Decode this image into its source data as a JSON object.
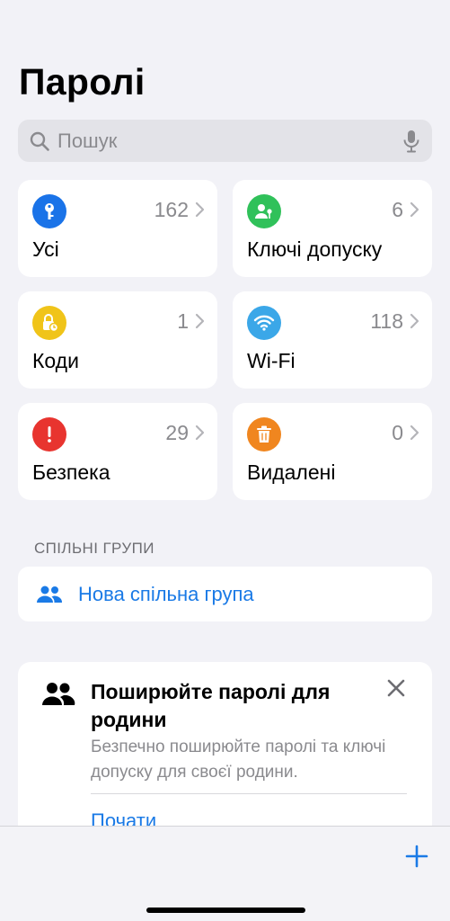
{
  "app": {
    "title": "Паролі"
  },
  "search": {
    "placeholder": "Пошук"
  },
  "tiles": [
    {
      "label": "Усі",
      "count": "162",
      "icon": "key-icon",
      "color": "#1a73e8"
    },
    {
      "label": "Ключі допуску",
      "count": "6",
      "icon": "person-key-icon",
      "color": "#30c15a"
    },
    {
      "label": "Коди",
      "count": "1",
      "icon": "lock-clock-icon",
      "color": "#f0c419"
    },
    {
      "label": "Wi-Fi",
      "count": "118",
      "icon": "wifi-icon",
      "color": "#3ba7e8"
    },
    {
      "label": "Безпека",
      "count": "29",
      "icon": "exclamation-icon",
      "color": "#e8342f"
    },
    {
      "label": "Видалені",
      "count": "0",
      "icon": "trash-icon",
      "color": "#f0861f"
    }
  ],
  "shared_groups": {
    "header": "СПІЛЬНІ ГРУПИ",
    "new_group_label": "Нова спільна група"
  },
  "promo": {
    "title": "Поширюйте паролі для родини",
    "text": "Безпечно поширюйте паролі та ключі допуску для своєї родини.",
    "action": "Почати"
  },
  "colors": {
    "accent": "#1a7ae6",
    "background": "#f2f2f7"
  }
}
